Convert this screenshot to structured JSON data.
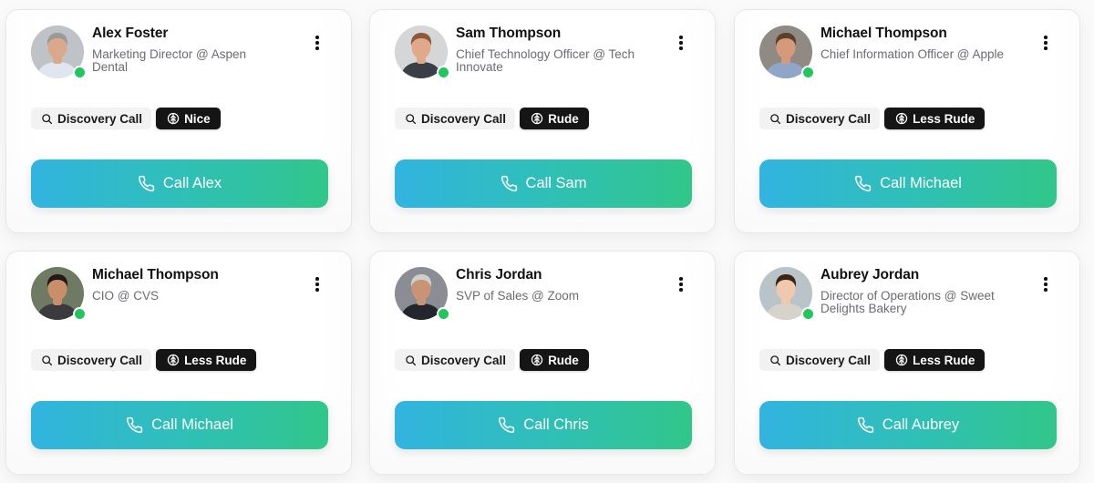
{
  "contacts": [
    {
      "name": "Alex Foster",
      "title": "Marketing Director @ Aspen Dental",
      "status": "online",
      "tags": {
        "scenario": "Discovery Call",
        "persona": "Nice"
      },
      "call_label": "Call Alex",
      "avatar": {
        "bg": "#bfc3c7",
        "skin": "#d9a98c",
        "hair": "#9a9a9a",
        "shirt": "#dfe6ef"
      }
    },
    {
      "name": "Sam Thompson",
      "title": "Chief Technology Officer @ Tech Innovate",
      "status": "online",
      "tags": {
        "scenario": "Discovery Call",
        "persona": "Rude"
      },
      "call_label": "Call Sam",
      "avatar": {
        "bg": "#d4d6d8",
        "skin": "#e0a98a",
        "hair": "#8a5a3b",
        "shirt": "#3a3f47"
      }
    },
    {
      "name": "Michael Thompson",
      "title": "Chief Information Officer @ Apple",
      "status": "online",
      "tags": {
        "scenario": "Discovery Call",
        "persona": "Less Rude"
      },
      "call_label": "Call Michael",
      "avatar": {
        "bg": "#8f8a84",
        "skin": "#d49a7a",
        "hair": "#5a3f2c",
        "shirt": "#8fa6c8"
      }
    },
    {
      "name": "Michael Thompson",
      "title": "CIO @ CVS",
      "status": "online",
      "tags": {
        "scenario": "Discovery Call",
        "persona": "Less Rude"
      },
      "call_label": "Call Michael",
      "avatar": {
        "bg": "#6f7a63",
        "skin": "#c98f6b",
        "hair": "#1e1a18",
        "shirt": "#3b3b3f"
      }
    },
    {
      "name": "Chris Jordan",
      "title": "SVP of Sales @ Zoom",
      "status": "online",
      "tags": {
        "scenario": "Discovery Call",
        "persona": "Rude"
      },
      "call_label": "Call Chris",
      "avatar": {
        "bg": "#8a8d93",
        "skin": "#c99476",
        "hair": "#cfcfcf",
        "shirt": "#23262c"
      }
    },
    {
      "name": "Aubrey Jordan",
      "title": "Director of Operations @ Sweet Delights Bakery",
      "status": "online",
      "tags": {
        "scenario": "Discovery Call",
        "persona": "Less Rude"
      },
      "call_label": "Call Aubrey",
      "avatar": {
        "bg": "#b9c4c9",
        "skin": "#efc9ad",
        "hair": "#3a2418",
        "shirt": "#d6d2cc"
      }
    }
  ],
  "icons": {
    "menu": "more-vertical-icon",
    "scenario": "search-icon",
    "persona": "brain-icon",
    "call": "phone-icon"
  },
  "colors": {
    "status_online": "#22c55e",
    "button_gradient_start": "#31b4e0",
    "button_gradient_end": "#31c68a",
    "persona_badge_bg": "#151515",
    "scenario_badge_bg": "#f2f2f3"
  }
}
